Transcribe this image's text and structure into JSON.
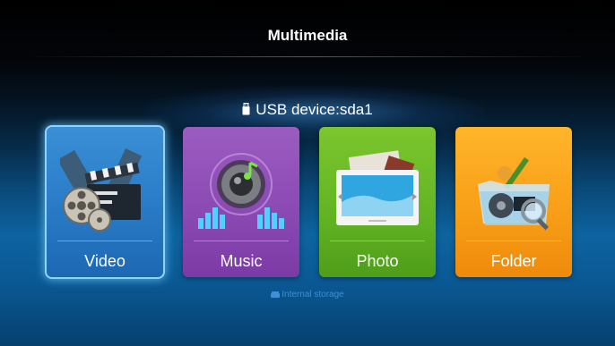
{
  "header": {
    "title": "Multimedia"
  },
  "device": {
    "icon": "usb-drive-icon",
    "label": "USB device:sda1"
  },
  "tiles": [
    {
      "label": "Video",
      "icon": "video-film-reel-icon",
      "color": "#2a7cc8",
      "selected": true
    },
    {
      "label": "Music",
      "icon": "music-speaker-icon",
      "color": "#8a48b3",
      "selected": false
    },
    {
      "label": "Photo",
      "icon": "photo-frame-icon",
      "color": "#62b323",
      "selected": false
    },
    {
      "label": "Folder",
      "icon": "folder-search-icon",
      "color": "#f79d16",
      "selected": false
    }
  ],
  "storage": {
    "icon": "hard-drive-icon",
    "label": "Internal storage"
  },
  "colors": {
    "accent": "#8fd3ff",
    "background_top": "#000000",
    "background_bottom": "#0d63a0"
  }
}
